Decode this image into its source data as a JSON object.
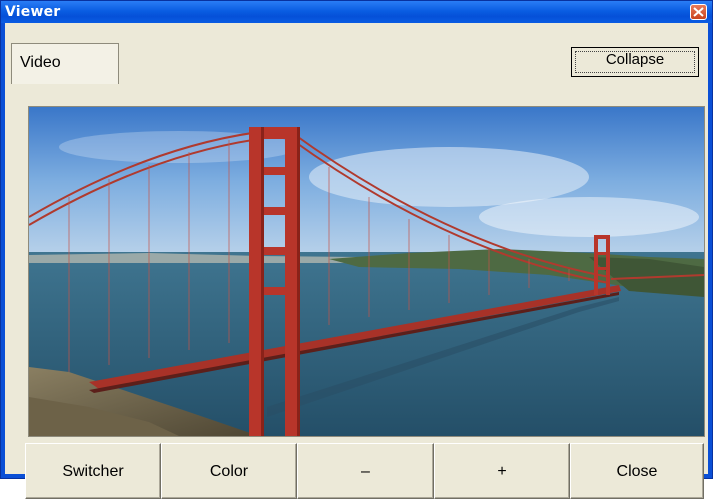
{
  "window": {
    "title": "Viewer"
  },
  "tabs": [
    {
      "label": "Video"
    }
  ],
  "header": {
    "collapse_label": "Collapse"
  },
  "buttons": [
    {
      "label": "Switcher"
    },
    {
      "label": "Color"
    },
    {
      "label": "–"
    },
    {
      "label": "+"
    },
    {
      "label": "Close"
    }
  ],
  "colors": {
    "titlebar": "#0a5de2",
    "client": "#ece9d8",
    "bridge": "#c0392b"
  },
  "icons": {
    "close": "close-icon"
  },
  "image": {
    "subject": "golden-gate-bridge"
  }
}
